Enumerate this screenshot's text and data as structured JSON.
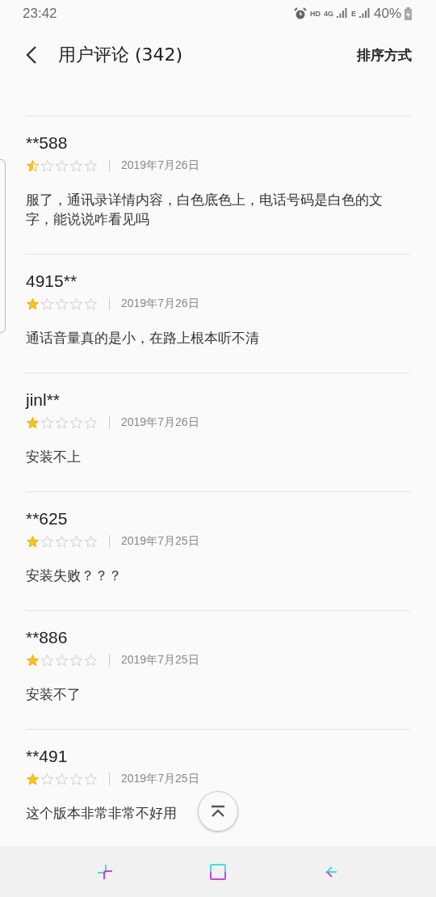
{
  "status_bar": {
    "time": "23:42",
    "hd": "HD",
    "network": "4G",
    "network_2": "E",
    "battery": "40%"
  },
  "header": {
    "title": "用户评论 (342)",
    "sort": "排序方式"
  },
  "reviews": [
    {
      "user": "**588",
      "stars": 0.5,
      "date": "2019年7月26日",
      "text": "服了，通讯录详情内容，白色底色上，电话号码是白色的文字，能说说咋看见吗"
    },
    {
      "user": "4915**",
      "stars": 1,
      "date": "2019年7月26日",
      "text": "通话音量真的是小，在路上根本听不清"
    },
    {
      "user": "jinl**",
      "stars": 1,
      "date": "2019年7月26日",
      "text": "安装不上"
    },
    {
      "user": "**625",
      "stars": 1,
      "date": "2019年7月25日",
      "text": "安装失败？？？"
    },
    {
      "user": "**886",
      "stars": 1,
      "date": "2019年7月25日",
      "text": "安装不了"
    },
    {
      "user": "**491",
      "stars": 1,
      "date": "2019年7月25日",
      "text": "这个版本非常非常不好用"
    }
  ]
}
